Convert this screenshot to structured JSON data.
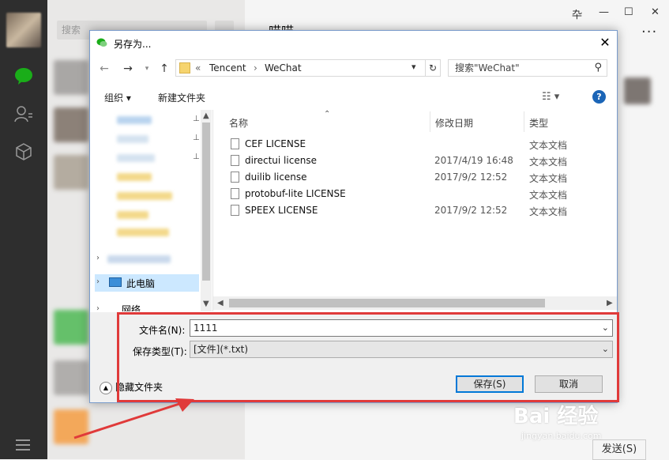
{
  "wechat": {
    "search_placeholder": "搜索",
    "chat_title": "喵喵",
    "send_label": "发送(S)",
    "win_controls": [
      "卆",
      "—",
      "☐",
      "✕"
    ],
    "more_label": "···"
  },
  "dialog": {
    "title": "另存为...",
    "close_label": "✕",
    "breadcrumb": [
      "«",
      "Tencent",
      "›",
      "WeChat"
    ],
    "search_placeholder": "搜索\"WeChat\"",
    "toolbar": {
      "organize": "组织 ▾",
      "new_folder": "新建文件夹",
      "view": "☷ ▾",
      "help": "?"
    },
    "nav": {
      "this_pc": "此电脑",
      "network": "网络"
    },
    "columns": {
      "name": "名称",
      "modified": "修改日期",
      "type": "类型"
    },
    "files": [
      {
        "name": "CEF LICENSE",
        "date": "",
        "type": "文本文档"
      },
      {
        "name": "directui license",
        "date": "2017/4/19 16:48",
        "type": "文本文档"
      },
      {
        "name": "duilib license",
        "date": "2017/9/2 12:52",
        "type": "文本文档"
      },
      {
        "name": "protobuf-lite LICENSE",
        "date": "",
        "type": "文本文档"
      },
      {
        "name": "SPEEX LICENSE",
        "date": "2017/9/2 12:52",
        "type": "文本文档"
      }
    ],
    "filename_label": "文件名(N):",
    "filename_value": "1111",
    "filetype_label": "保存类型(T):",
    "filetype_value": "[文件](*.txt)",
    "hide_folders": "隐藏文件夹",
    "save_button": "保存(S)",
    "cancel_button": "取消"
  },
  "watermark": {
    "main": "Bai 经验",
    "sub": "jingyan.baidu.com"
  },
  "colors": {
    "accent": "#0078d7",
    "annotation": "#e03a3a",
    "wechat_green": "#1aad19"
  }
}
